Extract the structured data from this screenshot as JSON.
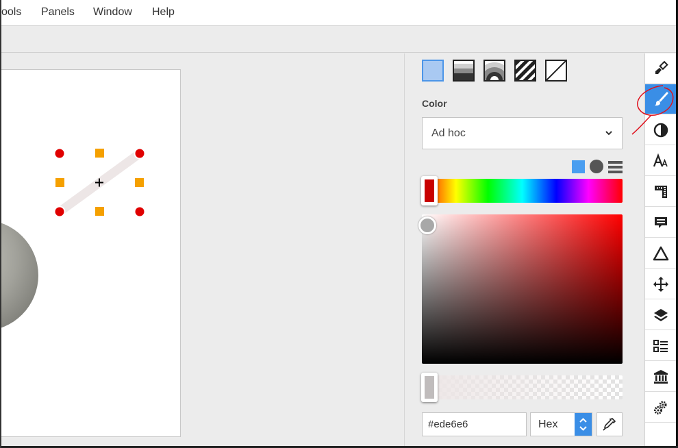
{
  "menu": {
    "items": [
      {
        "label": "ools"
      },
      {
        "label": "Panels"
      },
      {
        "label": "Window"
      },
      {
        "label": "Help"
      }
    ]
  },
  "style_panel": {
    "fill_types": [
      "solid-fill-icon",
      "gradient-fill-icon",
      "radial-fill-icon",
      "hatch-fill-icon",
      "no-fill-icon"
    ],
    "color_label": "Color",
    "color_mode": "Ad hoc",
    "color_view_modes": [
      "swatch-view-icon",
      "circle-view-icon",
      "list-view-icon"
    ],
    "hue_color": "#c80000",
    "hex_value": "#ede6e6",
    "format": "Hex"
  },
  "canvas": {
    "line_color": "#ede6e6",
    "handle_corner_color": "#e00000",
    "handle_mid_color": "#f5a000"
  },
  "sidebar": {
    "items": [
      {
        "icon": "brush-paint-icon",
        "active": false
      },
      {
        "icon": "paintbrush-icon",
        "active": true
      },
      {
        "icon": "contrast-icon",
        "active": false
      },
      {
        "icon": "text-style-icon",
        "active": false
      },
      {
        "icon": "ruler-icon",
        "active": false
      },
      {
        "icon": "comment-icon",
        "active": false
      },
      {
        "icon": "triangle-icon",
        "active": false
      },
      {
        "icon": "move-icon",
        "active": false
      },
      {
        "icon": "layers-icon",
        "active": false
      },
      {
        "icon": "list-icon",
        "active": false
      },
      {
        "icon": "library-icon",
        "active": false
      },
      {
        "icon": "settings-gears-icon",
        "active": false
      }
    ]
  },
  "colors": {
    "accent": "#3a8ee6",
    "annotation": "#e0101c"
  }
}
